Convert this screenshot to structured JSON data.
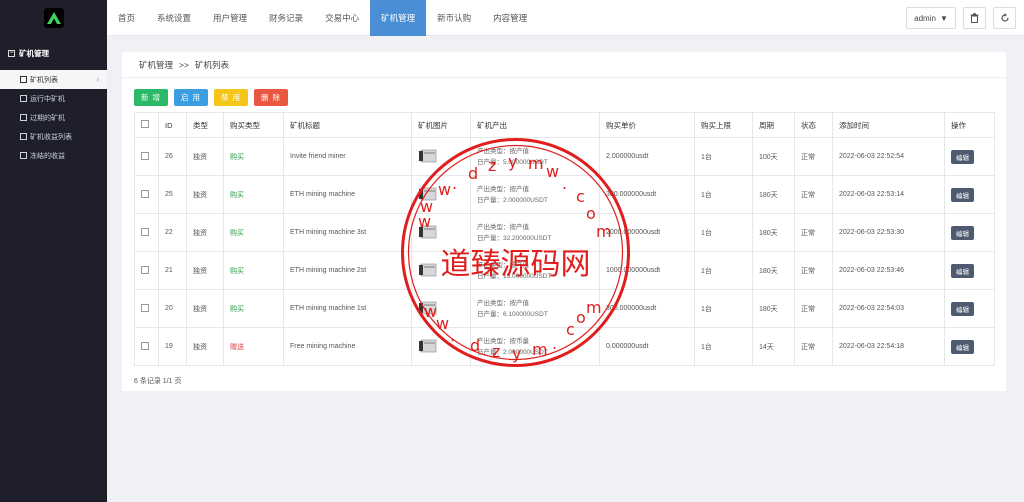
{
  "sidebar": {
    "group_label": "矿机管理",
    "items": [
      {
        "label": "矿机列表",
        "active": true
      },
      {
        "label": "运行中矿机"
      },
      {
        "label": "过期的矿机"
      },
      {
        "label": "矿机收益列表"
      },
      {
        "label": "冻结的收益"
      }
    ]
  },
  "topnav": {
    "items": [
      "首页",
      "系统设置",
      "用户管理",
      "财务记录",
      "交易中心",
      "矿机管理",
      "新币认购",
      "内容管理"
    ],
    "active_index": 5,
    "admin_label": "admin"
  },
  "breadcrumb": {
    "parent": "矿机管理",
    "separator": ">>",
    "current": "矿机列表"
  },
  "actions": {
    "add": "新 增",
    "enable": "启 用",
    "disable": "禁 用",
    "delete": "删 除"
  },
  "table": {
    "headers": [
      "ID",
      "类型",
      "购买类型",
      "矿机标题",
      "矿机图片",
      "矿机产出",
      "购买单价",
      "购买上限",
      "周期",
      "状态",
      "添加时间",
      "操作"
    ],
    "rows": [
      {
        "id": "26",
        "type": "独资",
        "buy_type": "购买",
        "title": "Invite friend miner",
        "out1": "产出类型：按产值",
        "out2": "日产量：5.000000USDT",
        "price": "2.000000usdt",
        "limit": "1台",
        "cycle": "100天",
        "status": "正常",
        "time": "2022-06-03 22:52:54",
        "op": "编辑"
      },
      {
        "id": "25",
        "type": "独资",
        "buy_type": "购买",
        "title": "ETH mining machine",
        "out1": "产出类型：按产值",
        "out2": "日产量：2.000000USDT",
        "price": "300.000000usdt",
        "limit": "1台",
        "cycle": "180天",
        "status": "正常",
        "time": "2022-06-03 22:53:14",
        "op": "编辑"
      },
      {
        "id": "22",
        "type": "独资",
        "buy_type": "购买",
        "title": "ETH mining machine 3st",
        "out1": "产出类型：按产值",
        "out2": "日产量：32.200000USDT",
        "price": "2000.000000usdt",
        "limit": "1台",
        "cycle": "180天",
        "status": "正常",
        "time": "2022-06-03 22:53:30",
        "op": "编辑"
      },
      {
        "id": "21",
        "type": "独资",
        "buy_type": "购买",
        "title": "ETH mining machine 2st",
        "out1": "产出类型：按产值",
        "out2": "日产量：15.000000USDT",
        "price": "1000.000000usdt",
        "limit": "1台",
        "cycle": "180天",
        "status": "正常",
        "time": "2022-06-03 22:53:46",
        "op": "编辑"
      },
      {
        "id": "20",
        "type": "独资",
        "buy_type": "购买",
        "title": "ETH mining machine 1st",
        "out1": "产出类型：按产值",
        "out2": "日产量：6.100000USDT",
        "price": "300.000000usdt",
        "limit": "1台",
        "cycle": "180天",
        "status": "正常",
        "time": "2022-06-03 22:54:03",
        "op": "编辑"
      },
      {
        "id": "19",
        "type": "独资",
        "buy_type": "赠送",
        "title": "Free mining machine",
        "out1": "产出类型：按币量",
        "out2": "日产量：2.000000USDT",
        "price": "0.000000usdt",
        "limit": "1台",
        "cycle": "14天",
        "status": "正常",
        "time": "2022-06-03 22:54:18",
        "op": "编辑"
      }
    ]
  },
  "footer": {
    "count_text": "6 条记录 1/1 页"
  },
  "watermark": {
    "text": "道臻源码网",
    "url_top": "w w w . d z y m w . c o m",
    "url_bottom": "w w w . d z y m w . c o m"
  },
  "colors": {
    "nav_active": "#4a8fd6",
    "sidebar_bg": "#1e1f2b",
    "buy": "#2a9d43",
    "gift": "#e23b3b",
    "watermark": "#e01e1e"
  }
}
